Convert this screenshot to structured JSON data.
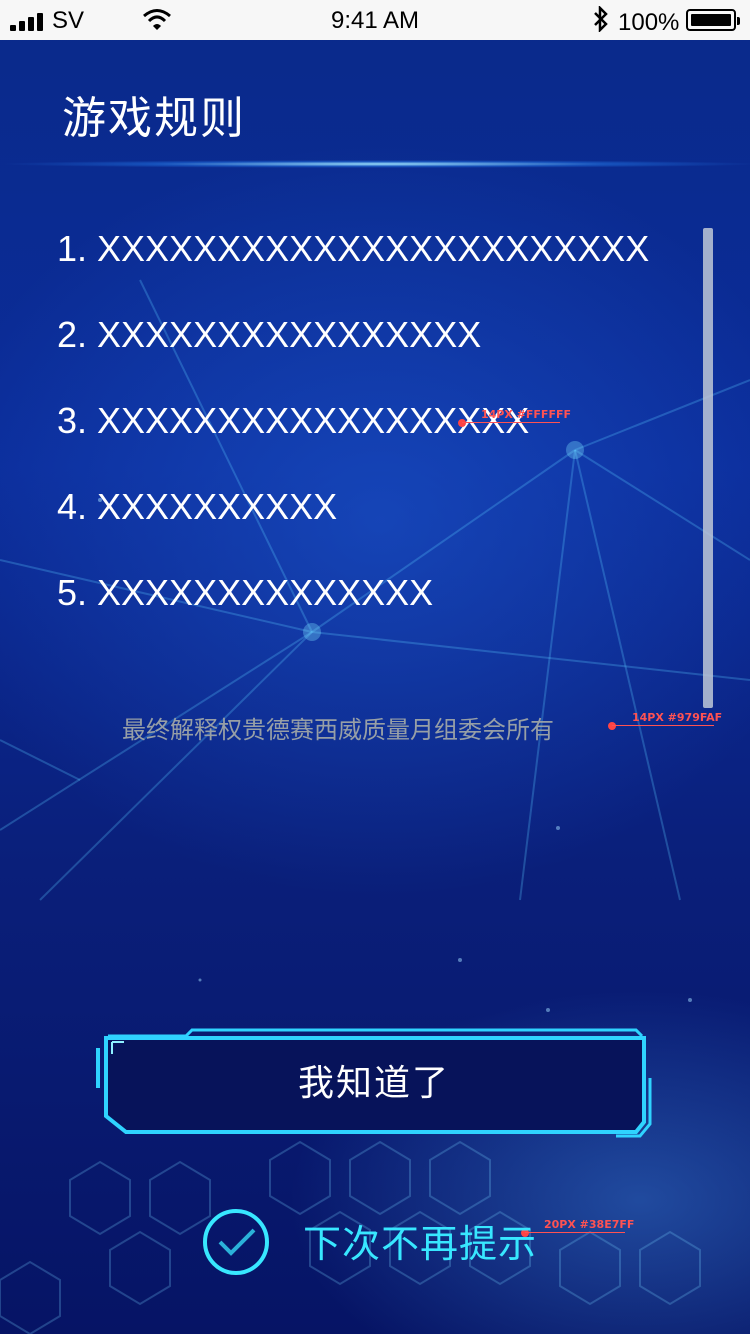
{
  "status_bar": {
    "carrier": "SV",
    "time": "9:41 AM",
    "battery": "100%",
    "bluetooth_icon": "bluetooth-icon"
  },
  "title": "游戏规则",
  "rules": [
    "1. XXXXXXXXXXXXXXXXXXXXXXX",
    "2. XXXXXXXXXXXXXXXX",
    "3. XXXXXXXXXXXXXXXXXX",
    "4. XXXXXXXXXX",
    "5. XXXXXXXXXXXXXX"
  ],
  "notice": "最终解释权贵德赛西威质量月组委会所有",
  "annotations": {
    "rules_spec": "14PX #FFFFFF",
    "notice_spec": "14PX #979FAF",
    "dont_show_spec": "20PX #38E7FF"
  },
  "confirm_button": "我知道了",
  "dont_show_again": {
    "label": "下次不再提示",
    "checked": true,
    "icon": "check-circle-icon"
  },
  "colors": {
    "accent": "#38E7FF",
    "notice_text": "#979FAF",
    "rule_text": "#FFFFFF",
    "background": "#0A2A8A"
  }
}
